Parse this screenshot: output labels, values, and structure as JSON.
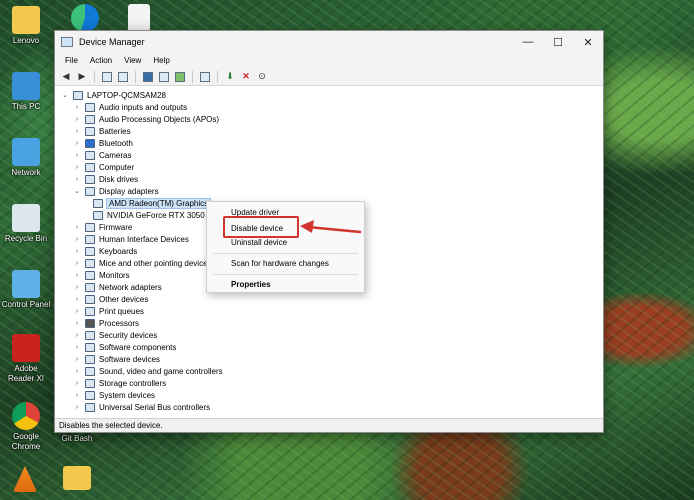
{
  "desktop": {
    "icons": [
      {
        "label": "Lenovo"
      },
      {
        "label": "This PC"
      },
      {
        "label": "Network"
      },
      {
        "label": "Recycle Bin"
      },
      {
        "label": "Control Panel"
      },
      {
        "label": "Adobe Reader XI"
      },
      {
        "label": "Google Chrome"
      },
      {
        "label": "Git Bash"
      }
    ]
  },
  "window": {
    "title": "Device Manager",
    "controls": {
      "minimize": "—",
      "maximize": "☐",
      "close": "✕"
    },
    "menu": [
      "File",
      "Action",
      "View",
      "Help"
    ]
  },
  "tree": {
    "root": "LAPTOP-QCMSAM28",
    "items": [
      {
        "label": "Audio inputs and outputs"
      },
      {
        "label": "Audio Processing Objects (APOs)"
      },
      {
        "label": "Batteries"
      },
      {
        "label": "Bluetooth"
      },
      {
        "label": "Cameras"
      },
      {
        "label": "Computer"
      },
      {
        "label": "Disk drives"
      },
      {
        "label": "Display adapters"
      },
      {
        "label": "AMD Radeon(TM) Graphics"
      },
      {
        "label": "NVIDIA GeForce RTX 3050 L"
      },
      {
        "label": "Firmware"
      },
      {
        "label": "Human Interface Devices"
      },
      {
        "label": "Keyboards"
      },
      {
        "label": "Mice and other pointing devices"
      },
      {
        "label": "Monitors"
      },
      {
        "label": "Network adapters"
      },
      {
        "label": "Other devices"
      },
      {
        "label": "Print queues"
      },
      {
        "label": "Processors"
      },
      {
        "label": "Security devices"
      },
      {
        "label": "Software components"
      },
      {
        "label": "Software devices"
      },
      {
        "label": "Sound, video and game controllers"
      },
      {
        "label": "Storage controllers"
      },
      {
        "label": "System devices"
      },
      {
        "label": "Universal Serial Bus controllers"
      }
    ]
  },
  "context_menu": {
    "update_driver": "Update driver",
    "disable_device": "Disable device",
    "uninstall_device": "Uninstall device",
    "scan": "Scan for hardware changes",
    "properties": "Properties"
  },
  "status": {
    "text": "Disables the selected device."
  },
  "colors": {
    "highlight_box": "#d0342c",
    "selection": "#cde2f5"
  }
}
